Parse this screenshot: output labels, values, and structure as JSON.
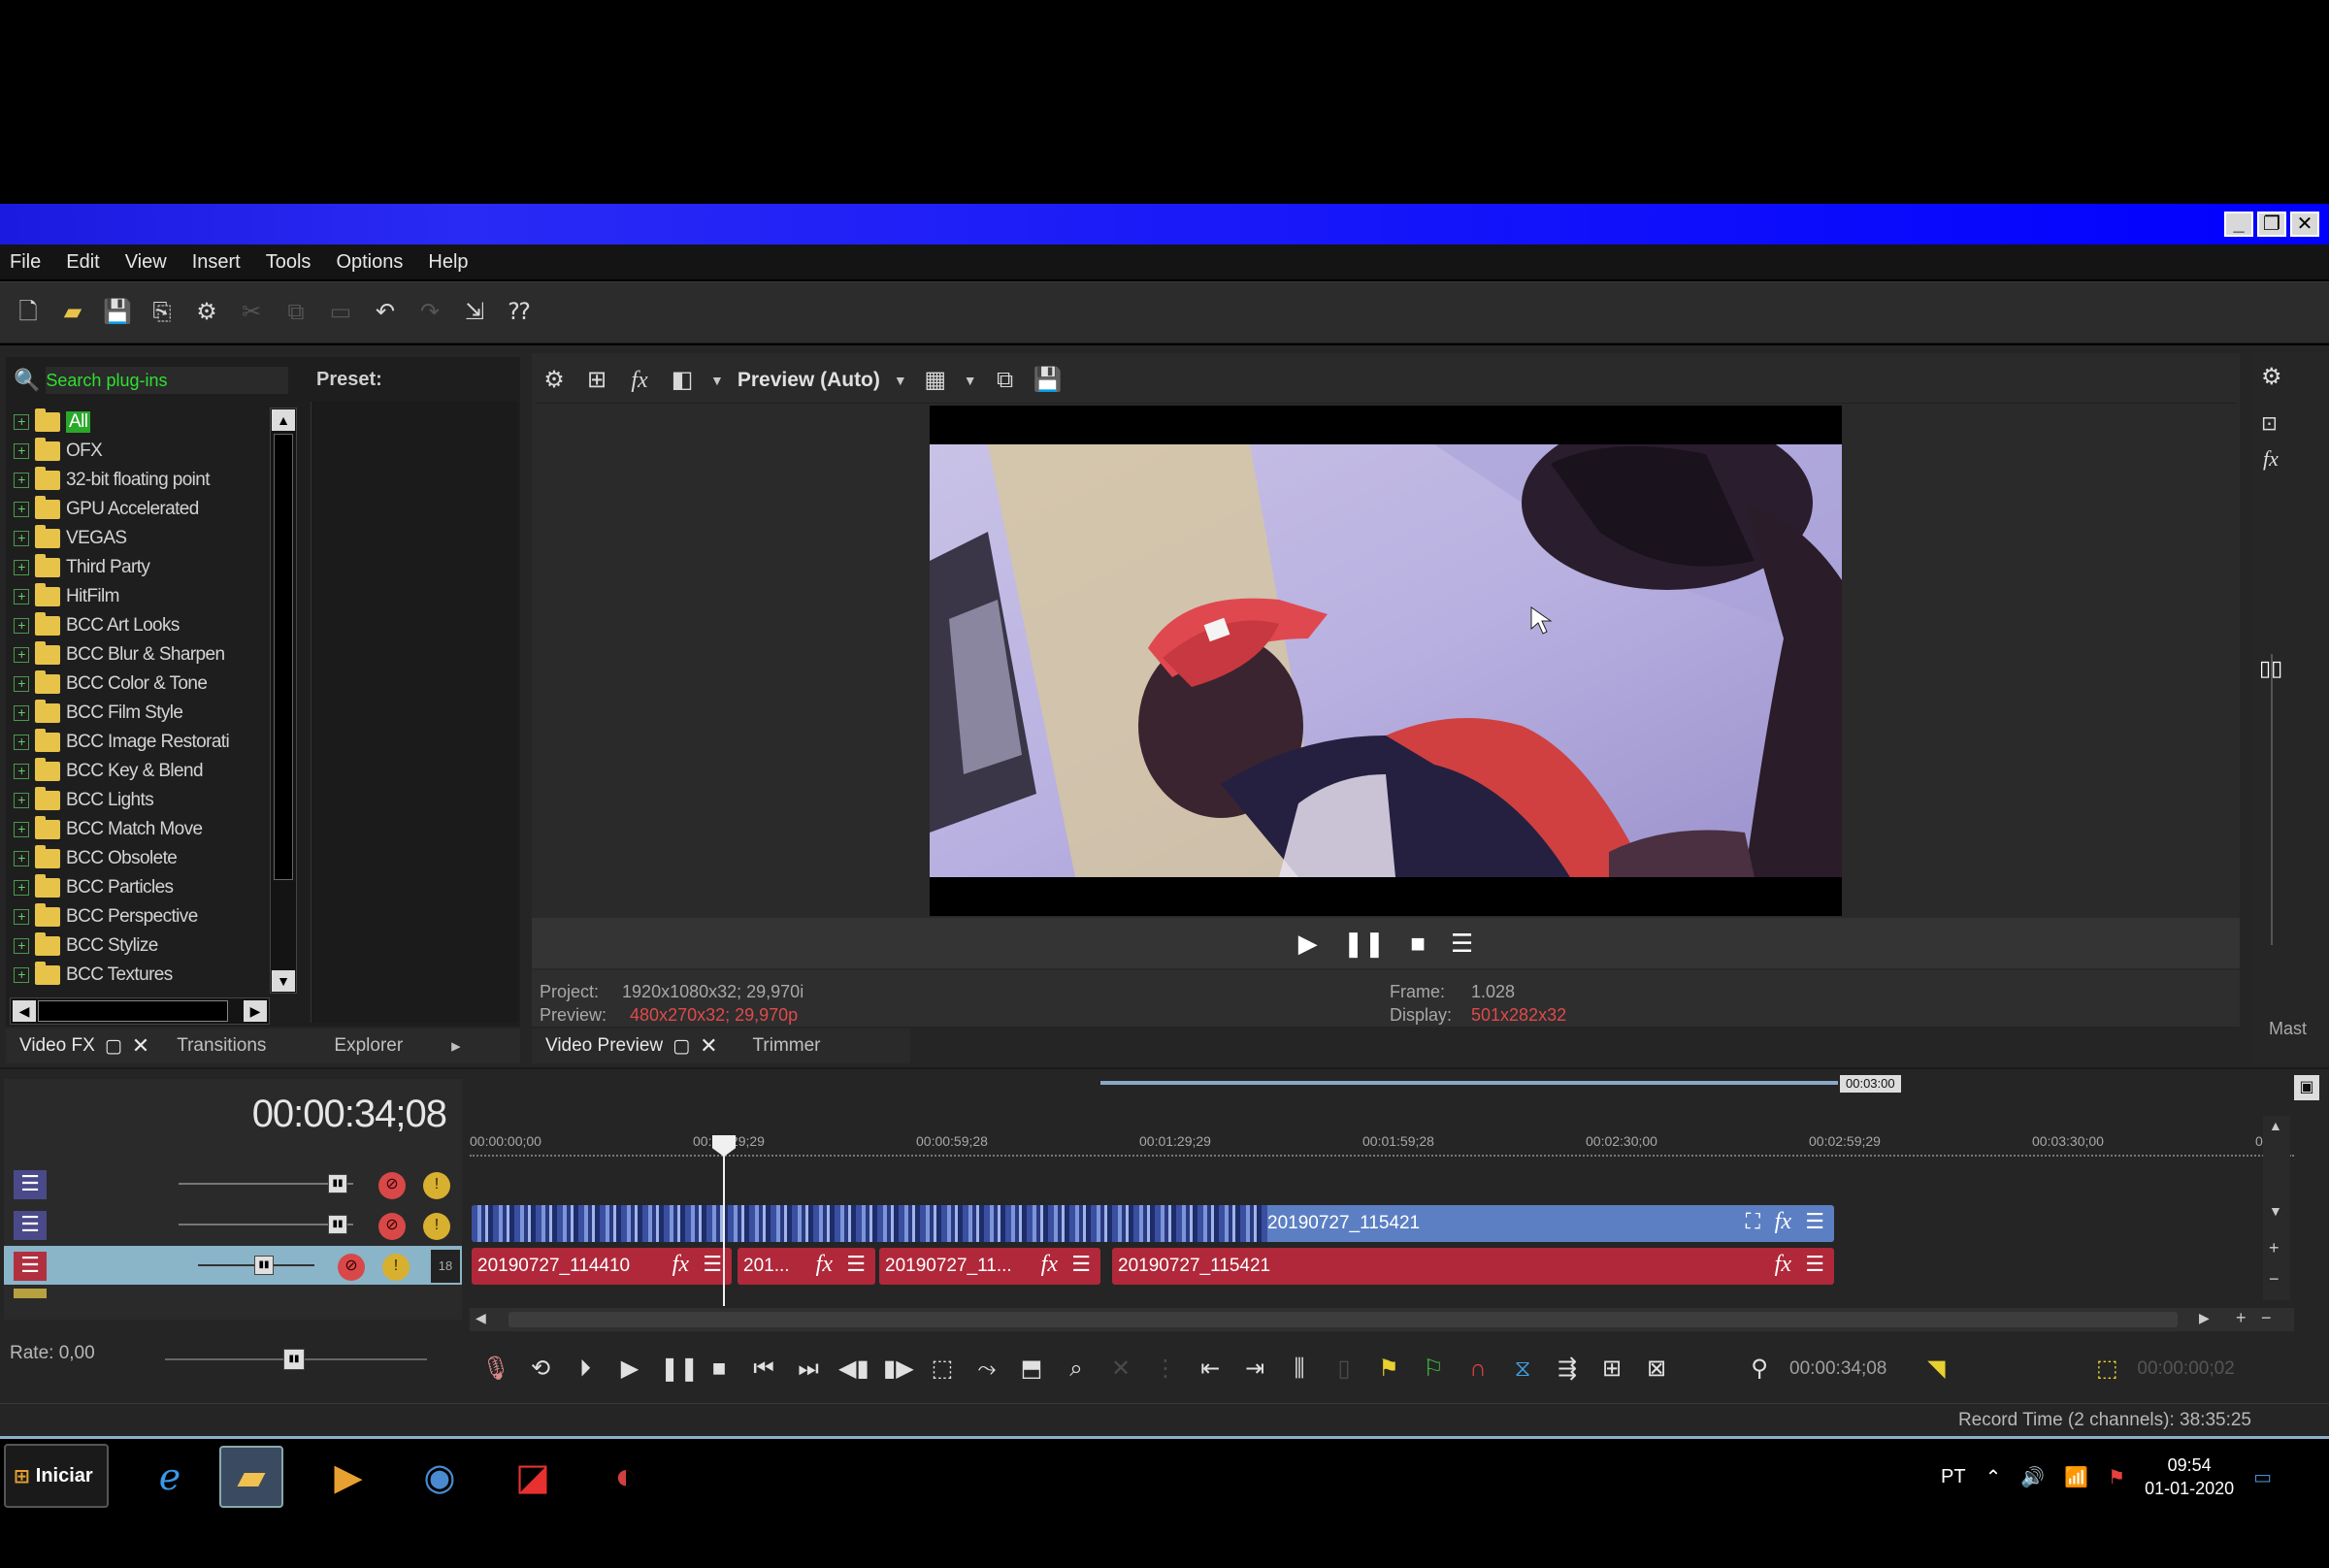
{
  "menu": [
    "File",
    "Edit",
    "View",
    "Insert",
    "Tools",
    "Options",
    "Help"
  ],
  "plugins": {
    "search_placeholder": "Search plug-ins",
    "preset_label": "Preset:",
    "items": [
      "All",
      "OFX",
      "32-bit floating point",
      "GPU Accelerated",
      "VEGAS",
      "Third Party",
      "HitFilm",
      "BCC Art Looks",
      "BCC Blur & Sharpen",
      "BCC Color & Tone",
      "BCC Film Style",
      "BCC Image Restorati",
      "BCC Key & Blend",
      "BCC Lights",
      "BCC Match Move",
      "BCC Obsolete",
      "BCC Particles",
      "BCC Perspective",
      "BCC Stylize",
      "BCC Textures"
    ],
    "selected": "All"
  },
  "left_tabs": {
    "video_fx": "Video FX",
    "transitions": "Transitions",
    "explorer": "Explorer"
  },
  "preview": {
    "mode": "Preview (Auto)",
    "project_label": "Project:",
    "project_value": "1920x1080x32; 29,970i",
    "preview_label": "Preview:",
    "preview_value": "480x270x32; 29,970p",
    "frame_label": "Frame:",
    "frame_value": "1.028",
    "display_label": "Display:",
    "display_value": "501x282x32"
  },
  "right_tabs": {
    "video_preview": "Video Preview",
    "trimmer": "Trimmer",
    "master": "Mast"
  },
  "timeline": {
    "timecode": "00:00:34;08",
    "loop_end": "00:03:00",
    "ruler_labels": [
      "00:00:00;00",
      "00:00:29;29",
      "00:00:59;28",
      "00:01:29;29",
      "00:01:59;28",
      "00:02:30;00",
      "00:02:59;29",
      "00:03:30;00",
      "00:0"
    ],
    "video_clip": "20190727_115421",
    "audio_clips": [
      "20190727_114410",
      "201...",
      "20190727_11...",
      "20190727_115421"
    ],
    "rate": "Rate: 0,00",
    "bottom_timecode": "00:00:34;08",
    "bottom_timecode_2": "00:00:00;02",
    "track_level": "18"
  },
  "status": {
    "record_time": "Record Time (2 channels): 38:35:25"
  },
  "taskbar": {
    "start": "Iniciar",
    "lang": "PT",
    "time": "09:54",
    "date": "01-01-2020"
  }
}
